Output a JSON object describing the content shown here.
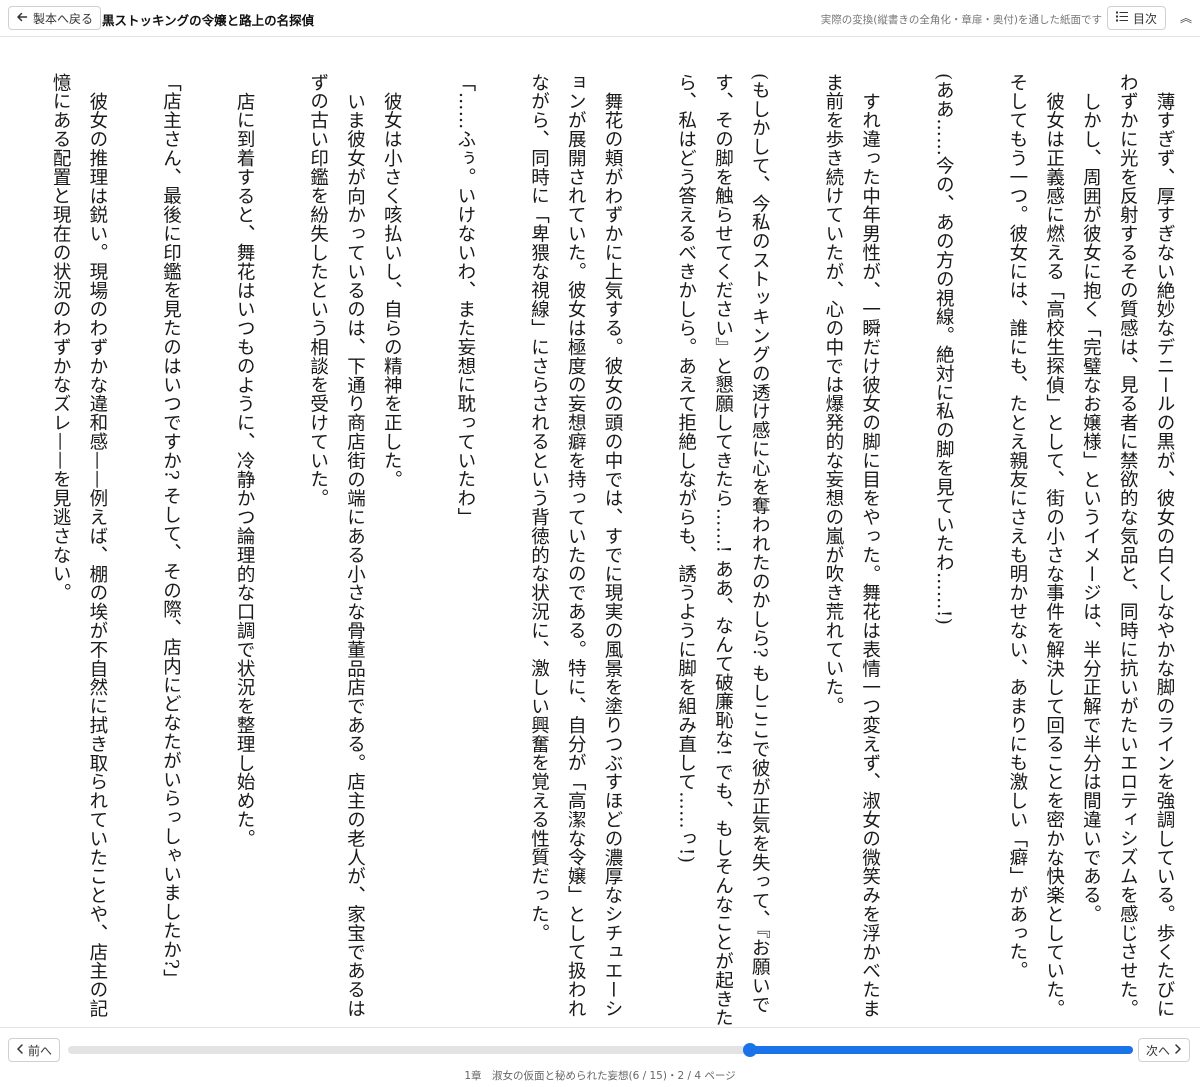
{
  "topbar": {
    "back_icon": "arrow-left-icon",
    "back_label": "製本へ戻る",
    "title": "黒ストッキングの令嬢と路上の名探偵",
    "note": "実際の変換(縦書きの全角化・章扉・奥付)を通した紙面です",
    "toc_icon": "list-icon",
    "toc_label": "目次",
    "collapse_icon": "double-chevron-up-icon",
    "collapse_glyph": "︽"
  },
  "body_paragraphs": [
    "薄すぎず、厚すぎない絶妙なデニールの黒が、彼女の白くしなやかな脚のラインを強調している。歩くたびにわずかに光を反射するその質感は、見る者に禁欲的な気品と、同時に抗いがたいエロティシズムを感じさせた。",
    "しかし、周囲が彼女に抱く「完璧なお嬢様」というイメージは、半分正解で半分は間違いである。",
    "彼女は正義感に燃える「高校生探偵」として、街の小さな事件を解決して回ることを密かな快楽としていた。そしてもう一つ。彼女には、誰にも、たとえ親友にさえも明かせない、あまりにも激しい「癖」があった。",
    "",
    "(ああ……今の、あの方の視線。絶対に私の脚を見ていたわ……!)",
    "",
    "すれ違った中年男性が、一瞬だけ彼女の脚に目をやった。舞花は表情一つ変えず、淑女の微笑みを浮かべたまま前を歩き続けていたが、心の中では爆発的な妄想の嵐が吹き荒れていた。",
    "",
    "(もしかして、今私のストッキングの透け感に心を奪われたのかしら? もしここで彼が正気を失って、『お願いです、その脚を触らせてください』と懇願してきたら……! ああ、なんて破廉恥な! でも、もしそんなことが起きたら、私はどう答えるべきかしら。あえて拒絶しながらも、誘うように脚を組み直して……っ!)",
    "",
    "舞花の頬がわずかに上気する。彼女の頭の中では、すでに現実の風景を塗りつぶすほどの濃厚なシチュエーションが展開されていた。彼女は極度の妄想癖を持っていたのである。特に、自分が「高潔な令嬢」として扱われながら、同時に「卑猥な視線」にさらされるという背徳的な状況に、激しい興奮を覚える性質だった。",
    "",
    "「……ふぅ。いけないわ、また妄想に耽っていたわ」",
    "",
    "彼女は小さく咳払いし、自らの精神を正した。",
    "いま彼女が向かっているのは、下通り商店街の端にある小さな骨董品店である。店主の老人が、家宝であるはずの古い印鑑を紛失したという相談を受けていた。",
    "",
    "店に到着すると、舞花はいつものように、冷静かつ論理的な口調で状況を整理し始めた。",
    "",
    "「店主さん、最後に印鑑を見たのはいつですか? そして、その際、店内にどなたがいらっしゃいましたか?」",
    "",
    "彼女の推理は鋭い。現場のわずかな違和感——例えば、棚の埃が不自然に拭き取られていたことや、店主の記憶にある配置と現在の状況のわずかなズレ——を見逃さない。"
  ],
  "footer": {
    "prev_label": "前へ",
    "prev_icon": "chevron-left-icon",
    "next_label": "次へ",
    "next_icon": "chevron-right-icon",
    "progress_fraction": 0.64,
    "page_info": "1章　淑女の仮面と秘められた妄想(6 / 15)・2 / 4 ページ"
  }
}
